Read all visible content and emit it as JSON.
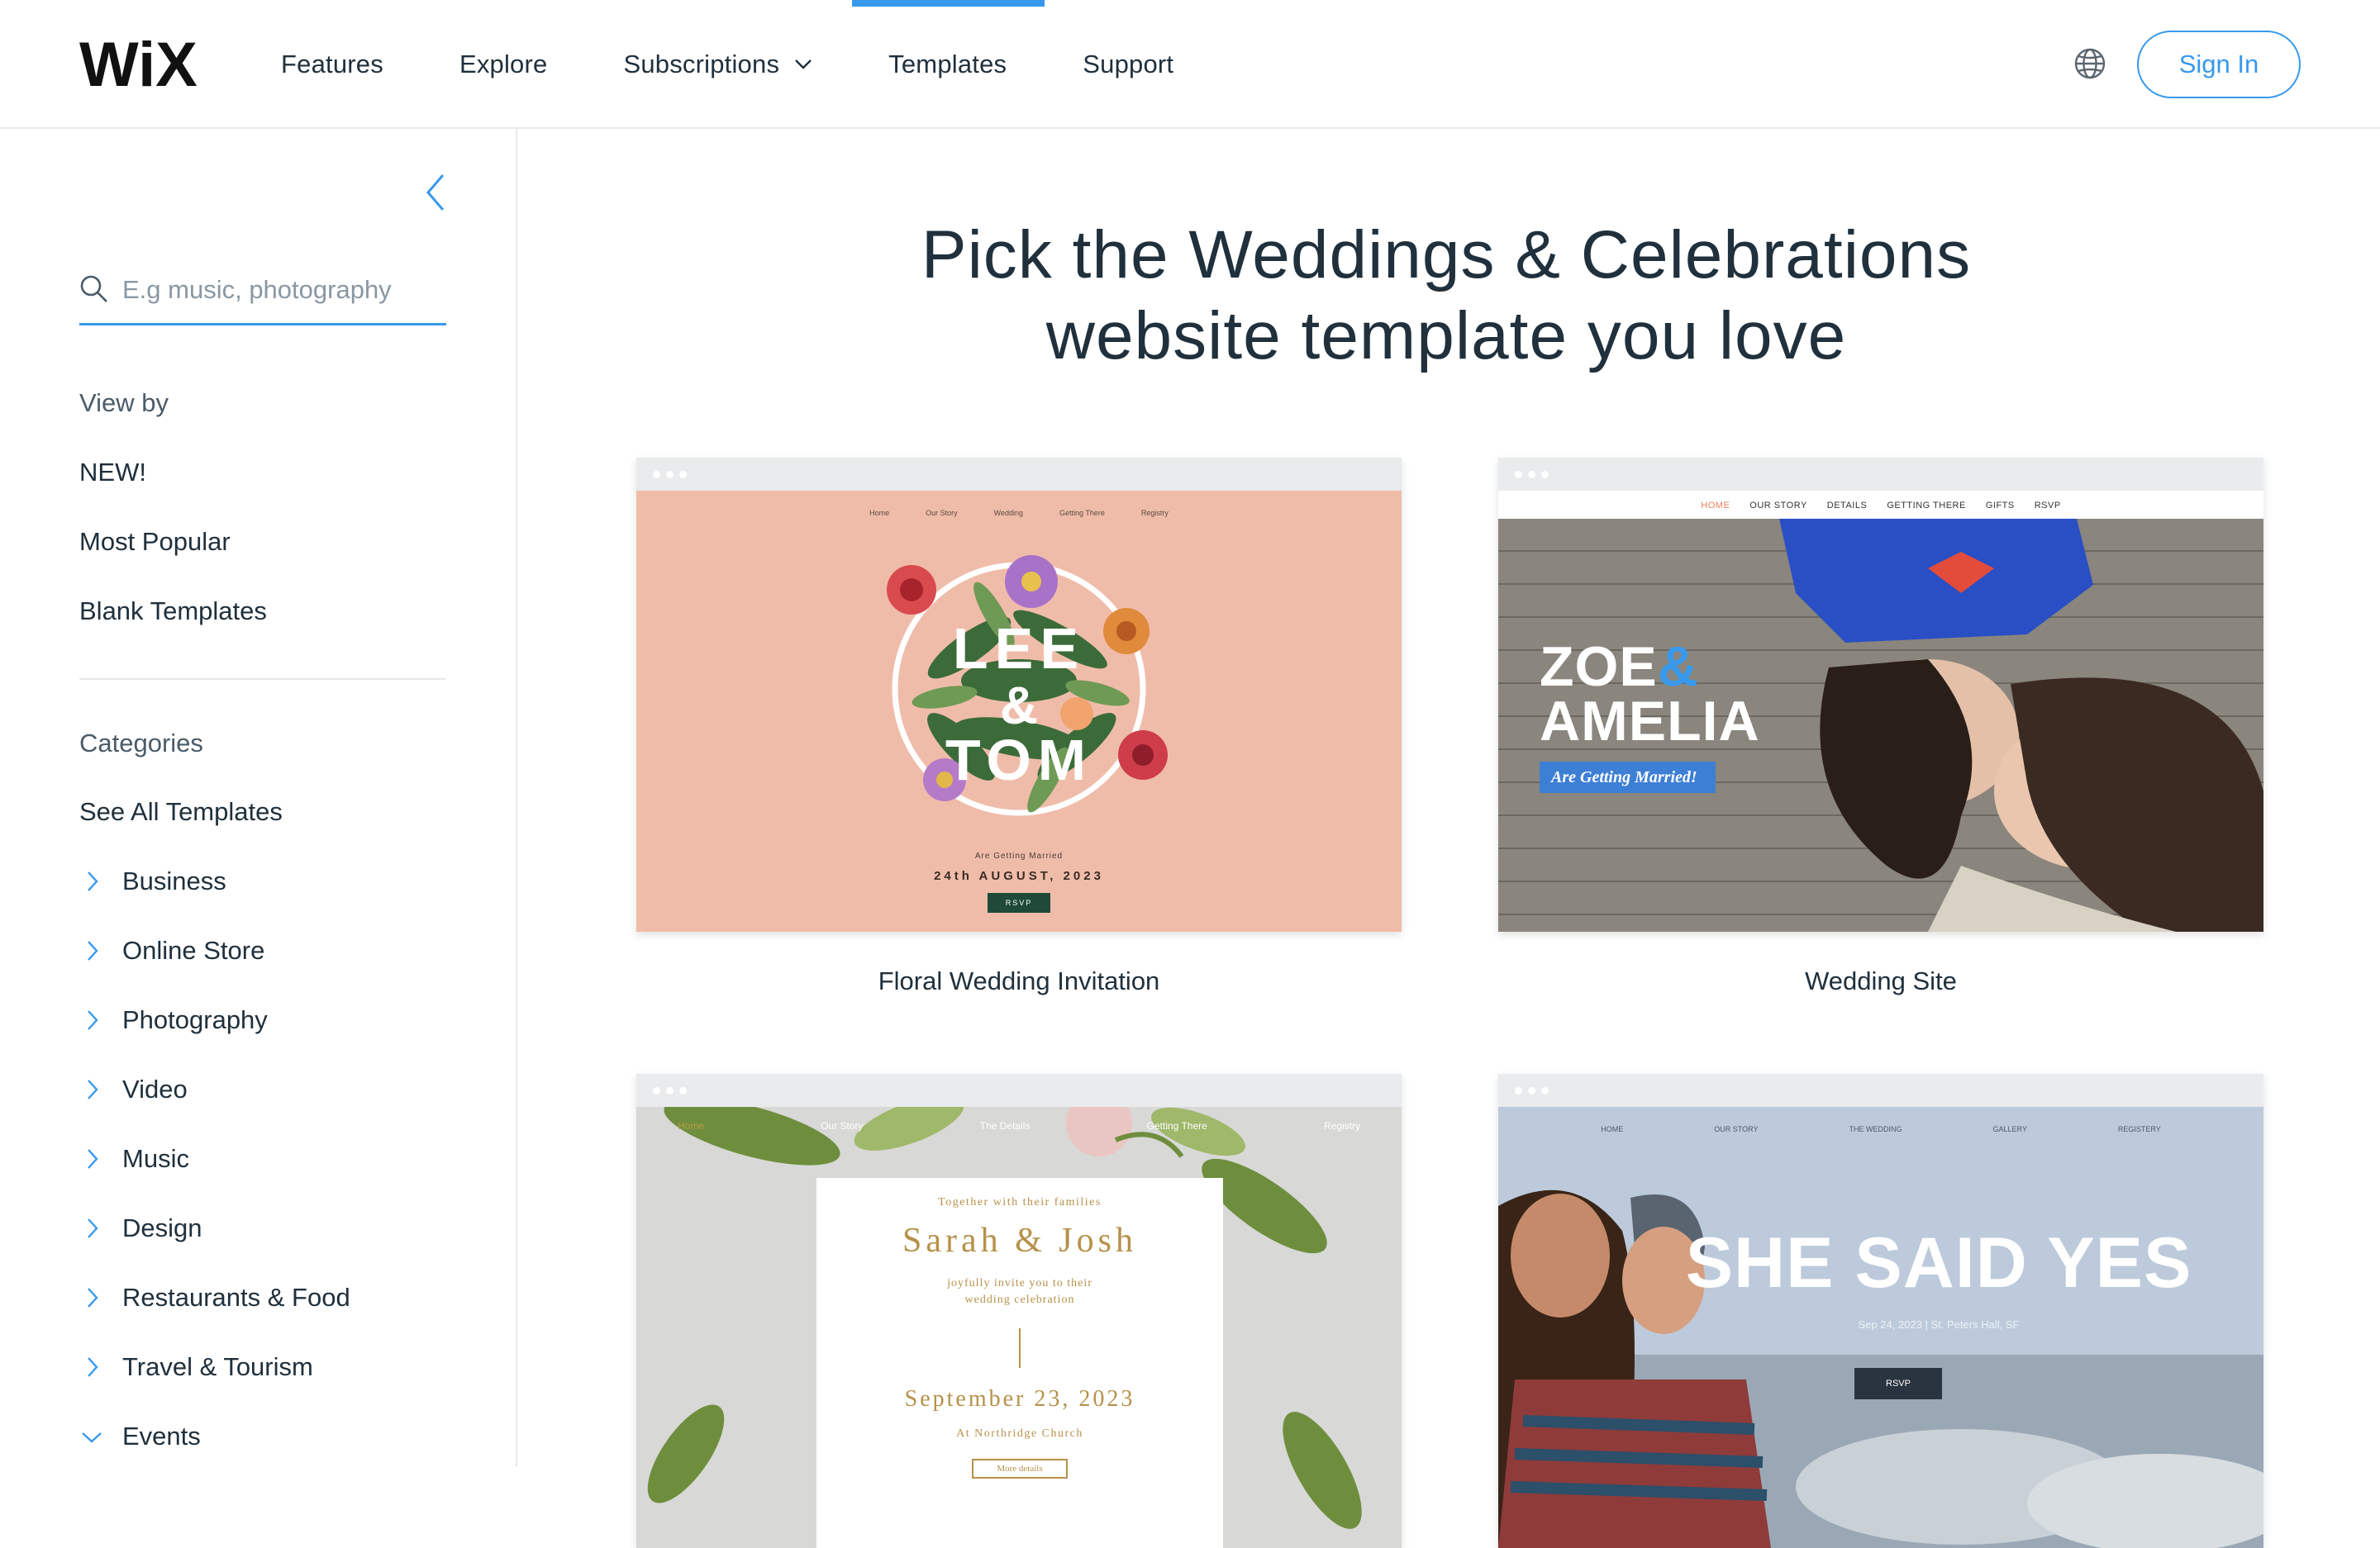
{
  "brand": {
    "logo_text": "WiX"
  },
  "nav": {
    "items": [
      {
        "label": "Features"
      },
      {
        "label": "Explore"
      },
      {
        "label": "Subscriptions"
      },
      {
        "label": "Templates"
      },
      {
        "label": "Support"
      }
    ],
    "active": "Templates",
    "signin_label": "Sign In",
    "accent_color": "#3899ec"
  },
  "sidebar": {
    "search_placeholder": "E.g music, photography",
    "view_by_label": "View by",
    "view_by_items": [
      "NEW!",
      "Most Popular",
      "Blank Templates"
    ],
    "categories_label": "Categories",
    "see_all_label": "See All Templates",
    "categories": [
      "Business",
      "Online Store",
      "Photography",
      "Video",
      "Music",
      "Design",
      "Restaurants & Food",
      "Travel & Tourism",
      "Events"
    ]
  },
  "main": {
    "headline_line1": "Pick the Weddings & Celebrations",
    "headline_line2": "website template you love",
    "templates": [
      {
        "title": "Floral Wedding Invitation",
        "preview": {
          "nav": [
            "Home",
            "Our Story",
            "Wedding",
            "Getting There",
            "Registry"
          ],
          "name1": "LEE",
          "amp": "&",
          "name2": "TOM",
          "subtitle": "Are Getting Married",
          "date": "24th AUGUST, 2023",
          "button": "RSVP",
          "bg_color": "#f0bcaa"
        }
      },
      {
        "title": "Wedding Site",
        "preview": {
          "nav": [
            "HOME",
            "OUR STORY",
            "DETAILS",
            "GETTING THERE",
            "GIFTS",
            "RSVP"
          ],
          "name1": "ZOE",
          "amp": "&",
          "name2": "AMELIA",
          "ribbon": "Are Getting Married!"
        }
      },
      {
        "title": "",
        "preview": {
          "nav": [
            "Home",
            "Our Story",
            "The Details",
            "Getting There",
            "Registry"
          ],
          "intro": "Together with their families",
          "names": "Sarah & Josh",
          "invite_line1": "joyfully invite you to their",
          "invite_line2": "wedding celebration",
          "date": "September 23, 2023",
          "venue": "At Northridge Church",
          "button": "More details"
        }
      },
      {
        "title": "",
        "preview": {
          "nav": [
            "HOME",
            "OUR STORY",
            "THE WEDDING",
            "GALLERY",
            "REGISTERY"
          ],
          "headline": "SHE SAID YES",
          "date": "Sep 24, 2023",
          "venue": "St. Peters Hall, SF",
          "button": "RSVP"
        }
      }
    ]
  }
}
